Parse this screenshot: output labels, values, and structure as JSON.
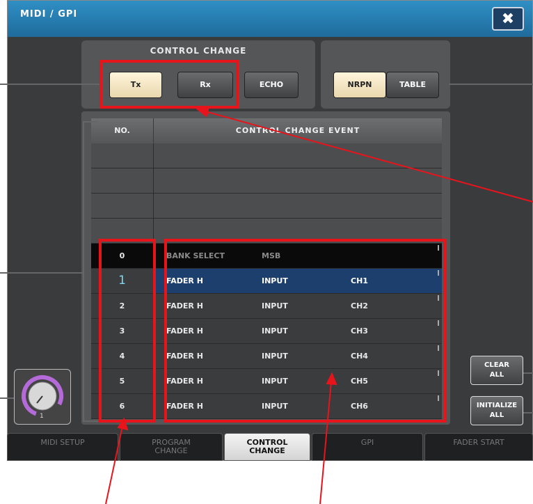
{
  "window": {
    "title": "MIDI / GPI",
    "close_label": "✖"
  },
  "control_change": {
    "label": "CONTROL CHANGE",
    "buttons": [
      {
        "label": "Tx",
        "active": true
      },
      {
        "label": "Rx",
        "active": false
      },
      {
        "label": "ECHO",
        "active": false
      }
    ]
  },
  "nrpn_table": {
    "buttons": [
      {
        "label": "NRPN",
        "active": true
      },
      {
        "label": "TABLE",
        "active": false
      }
    ]
  },
  "table": {
    "headers": {
      "no": "NO.",
      "event": "CONTROL CHANGE EVENT"
    },
    "rows": [
      {
        "no": "0",
        "c1": "BANK SELECT",
        "c2": "MSB",
        "c3": ""
      },
      {
        "no": "1",
        "c1": "FADER H",
        "c2": "INPUT",
        "c3": "CH1"
      },
      {
        "no": "2",
        "c1": "FADER H",
        "c2": "INPUT",
        "c3": "CH2"
      },
      {
        "no": "3",
        "c1": "FADER H",
        "c2": "INPUT",
        "c3": "CH3"
      },
      {
        "no": "4",
        "c1": "FADER H",
        "c2": "INPUT",
        "c3": "CH4"
      },
      {
        "no": "5",
        "c1": "FADER H",
        "c2": "INPUT",
        "c3": "CH5"
      },
      {
        "no": "6",
        "c1": "FADER H",
        "c2": "INPUT",
        "c3": "CH6"
      }
    ]
  },
  "side_buttons": {
    "clear_all": "CLEAR\nALL",
    "initialize_all": "INITIALIZE\nALL"
  },
  "knob": {
    "value": "1",
    "ring_color": "#b56ad9"
  },
  "tabs": [
    {
      "label": "MIDI SETUP",
      "active": false
    },
    {
      "label": "PROGRAM\nCHANGE",
      "active": false
    },
    {
      "label": "CONTROL\nCHANGE",
      "active": true
    },
    {
      "label": "GPI",
      "active": false
    },
    {
      "label": "FADER START",
      "active": false
    }
  ],
  "colors": {
    "title_bar": "#2a86bd",
    "highlight": "#e8141b",
    "selected_row": "#1c3f6e",
    "active_button": "#f3e6c4"
  }
}
